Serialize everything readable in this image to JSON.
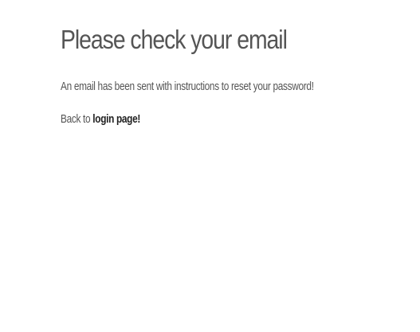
{
  "page": {
    "title": "Please check your email",
    "message": "An email has been sent with instructions to reset your password!",
    "back_prefix": "Back to ",
    "login_link_label": "login page!"
  },
  "colors": {
    "text": "#555555",
    "link": "#222222",
    "background": "#ffffff"
  }
}
